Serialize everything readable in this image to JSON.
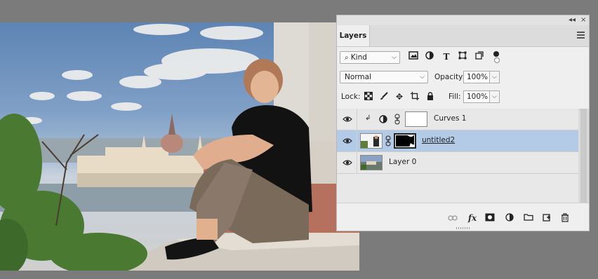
{
  "panel": {
    "tab_label": "Layers",
    "topbar_collapse": "◂◂",
    "topbar_close": "×",
    "filter": {
      "kind_label": "Kind",
      "icons": [
        "image-filter-icon",
        "adjustment-filter-icon",
        "type-filter-icon",
        "shape-filter-icon",
        "smart-object-filter-icon",
        "filter-toggle-icon"
      ]
    },
    "blend_mode": "Normal",
    "opacity_label": "Opacity:",
    "opacity_value": "100%",
    "lock_label": "Lock:",
    "lock_icons": [
      "lock-transparent-pixels-icon",
      "lock-image-pixels-icon",
      "lock-position-icon",
      "lock-artboard-icon",
      "lock-all-icon"
    ],
    "fill_label": "Fill:",
    "fill_value": "100%",
    "layers": [
      {
        "name": "Curves 1",
        "visible": true,
        "selected": false,
        "clipped": true,
        "type": "adjustment"
      },
      {
        "name": "untitled2",
        "visible": true,
        "selected": true,
        "clipped": false,
        "type": "masked-image"
      },
      {
        "name": "Layer 0",
        "visible": true,
        "selected": false,
        "clipped": false,
        "type": "image"
      }
    ],
    "bottom_icons": [
      "link-layers-icon",
      "fx-icon",
      "add-mask-icon",
      "new-adjustment-icon",
      "new-group-icon",
      "new-layer-icon",
      "delete-layer-icon"
    ],
    "fx_text": "fx"
  },
  "colors": {
    "selected_row": "#b3cbe6",
    "app_background": "#7b7b7b",
    "panel_background": "#efefef"
  }
}
